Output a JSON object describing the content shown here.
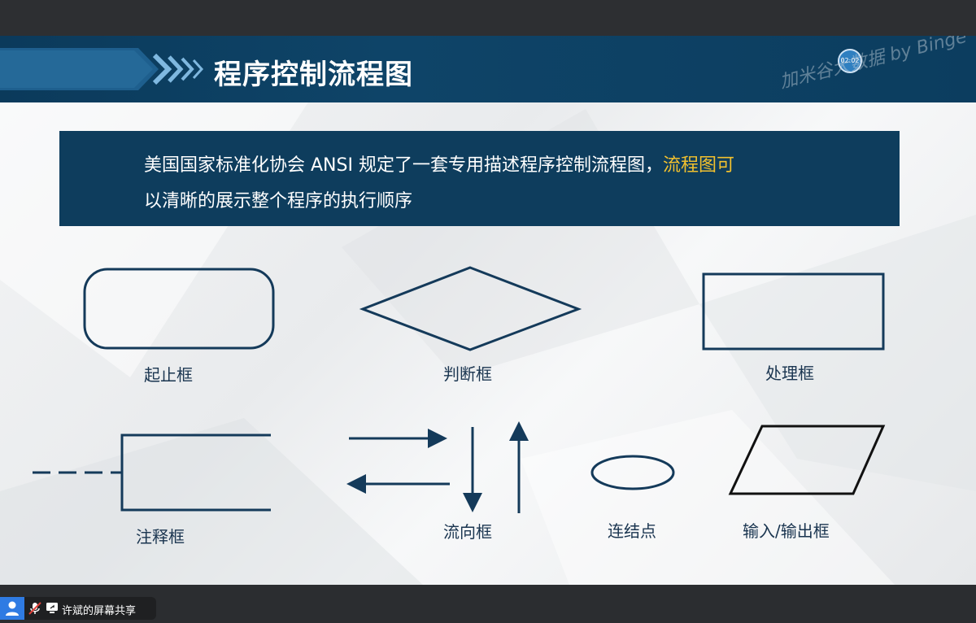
{
  "slide": {
    "title": "程序控制流程图",
    "timer": "02:02",
    "watermark": "加米谷大数据 by Binge",
    "callout": {
      "line1_plain": "美国国家标准化协会 ANSI 规定了一套专用描述程序控制流程图，",
      "line1_highlight": "流程图可",
      "line2_highlight": "以清晰的展示整个程序的执行顺序"
    },
    "shapes": {
      "start_end": "起止框",
      "decision": "判断框",
      "process": "处理框",
      "annotation": "注释框",
      "flow_line": "流向框",
      "connector": "连结点",
      "input_output": "输入/输出框"
    }
  },
  "screen_share": {
    "label": "许斌的屏幕共享"
  },
  "colors": {
    "header_bg": "#0e4468",
    "callout_bg": "#0e3d5d",
    "highlight": "#f2c12e",
    "shape_stroke": "#143a5a"
  }
}
